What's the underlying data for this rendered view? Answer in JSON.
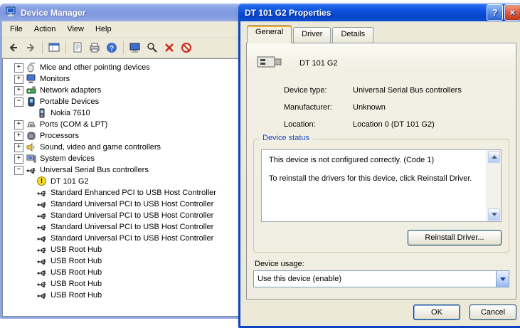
{
  "colors": {
    "titlebar_active": "#0B50DC",
    "titlebar_inactive": "#7E97DE",
    "window_face": "#ECE9D8",
    "warning_yellow": "#F6DC2A",
    "legend_blue": "#1A41C8"
  },
  "device_manager": {
    "title": "Device Manager",
    "menu": [
      "File",
      "Action",
      "View",
      "Help"
    ],
    "toolbar": [
      "back",
      "forward",
      "sep",
      "console-window",
      "sep",
      "properties",
      "print",
      "help",
      "sep",
      "update-driver",
      "scan-hardware",
      "uninstall",
      "disable"
    ],
    "tree": [
      {
        "label": "Mice and other pointing devices",
        "icon": "mouse",
        "expand": "+"
      },
      {
        "label": "Monitors",
        "icon": "monitor",
        "expand": "+"
      },
      {
        "label": "Network adapters",
        "icon": "network",
        "expand": "+"
      },
      {
        "label": "Portable Devices",
        "icon": "portable",
        "expand": "-",
        "children": [
          {
            "label": "Nokia 7610",
            "icon": "phone"
          }
        ]
      },
      {
        "label": "Ports (COM & LPT)",
        "icon": "ports",
        "expand": "+"
      },
      {
        "label": "Processors",
        "icon": "processor",
        "expand": "+"
      },
      {
        "label": "Sound, video and game controllers",
        "icon": "sound",
        "expand": "+"
      },
      {
        "label": "System devices",
        "icon": "system",
        "expand": "+"
      },
      {
        "label": "Universal Serial Bus controllers",
        "icon": "usb",
        "expand": "-",
        "children": [
          {
            "label": "DT 101 G2",
            "icon": "usb",
            "warning": true
          },
          {
            "label": "Standard Enhanced PCI to USB Host Controller",
            "icon": "usb"
          },
          {
            "label": "Standard Universal PCI to USB Host Controller",
            "icon": "usb"
          },
          {
            "label": "Standard Universal PCI to USB Host Controller",
            "icon": "usb"
          },
          {
            "label": "Standard Universal PCI to USB Host Controller",
            "icon": "usb"
          },
          {
            "label": "Standard Universal PCI to USB Host Controller",
            "icon": "usb"
          },
          {
            "label": "USB Root Hub",
            "icon": "usb"
          },
          {
            "label": "USB Root Hub",
            "icon": "usb"
          },
          {
            "label": "USB Root Hub",
            "icon": "usb"
          },
          {
            "label": "USB Root Hub",
            "icon": "usb"
          },
          {
            "label": "USB Root Hub",
            "icon": "usb"
          }
        ]
      }
    ]
  },
  "dialog": {
    "title": "DT 101 G2 Properties",
    "titlebar_buttons": {
      "help": "?",
      "close": "×"
    },
    "tabs": [
      {
        "label": "General",
        "active": true
      },
      {
        "label": "Driver",
        "active": false
      },
      {
        "label": "Details",
        "active": false
      }
    ],
    "device_name": "DT 101 G2",
    "fields": [
      {
        "label": "Device type:",
        "value": "Universal Serial Bus controllers"
      },
      {
        "label": "Manufacturer:",
        "value": "Unknown"
      },
      {
        "label": "Location:",
        "value": "Location 0 (DT 101 G2)"
      }
    ],
    "device_status": {
      "legend": "Device status",
      "lines": [
        "This device is not configured correctly. (Code 1)",
        "To reinstall the drivers for this device, click Reinstall Driver."
      ]
    },
    "device_usage": {
      "label": "Device usage:",
      "value": "Use this device (enable)"
    },
    "buttons": {
      "reinstall": "Reinstall Driver...",
      "ok": "OK",
      "cancel": "Cancel"
    }
  }
}
